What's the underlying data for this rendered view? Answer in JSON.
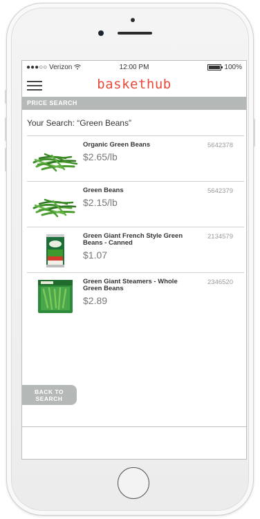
{
  "status": {
    "carrier": "●●●○○ Verizon",
    "wifi_icon": "wifi-icon",
    "time": "12:00 PM",
    "battery": "100%"
  },
  "header": {
    "menu_icon": "hamburger-menu-icon",
    "brand": "baskethub"
  },
  "section_title": "PRICE SEARCH",
  "search_summary": "Your Search: “Green Beans”",
  "results": [
    {
      "name": "Organic Green Beans",
      "price": "$2.65/lb",
      "code": "5642378",
      "image": "green-beans-image"
    },
    {
      "name": "Green Beans",
      "price": "$2.15/lb",
      "code": "5642379",
      "image": "green-beans-image"
    },
    {
      "name": "Green Giant French Style Green Beans - Canned",
      "price": "$1.07",
      "code": "2134579",
      "image": "canned-green-beans-image"
    },
    {
      "name": "Green Giant Steamers - Whole Green Beans",
      "price": "$2.89",
      "code": "2346520",
      "image": "frozen-green-beans-bag-image"
    }
  ],
  "back_button": {
    "line1": "BACK TO",
    "line2": "SEARCH"
  },
  "colors": {
    "brand": "#e84a3a",
    "section_bar": "#b4b8b6",
    "price_text": "#777777"
  }
}
